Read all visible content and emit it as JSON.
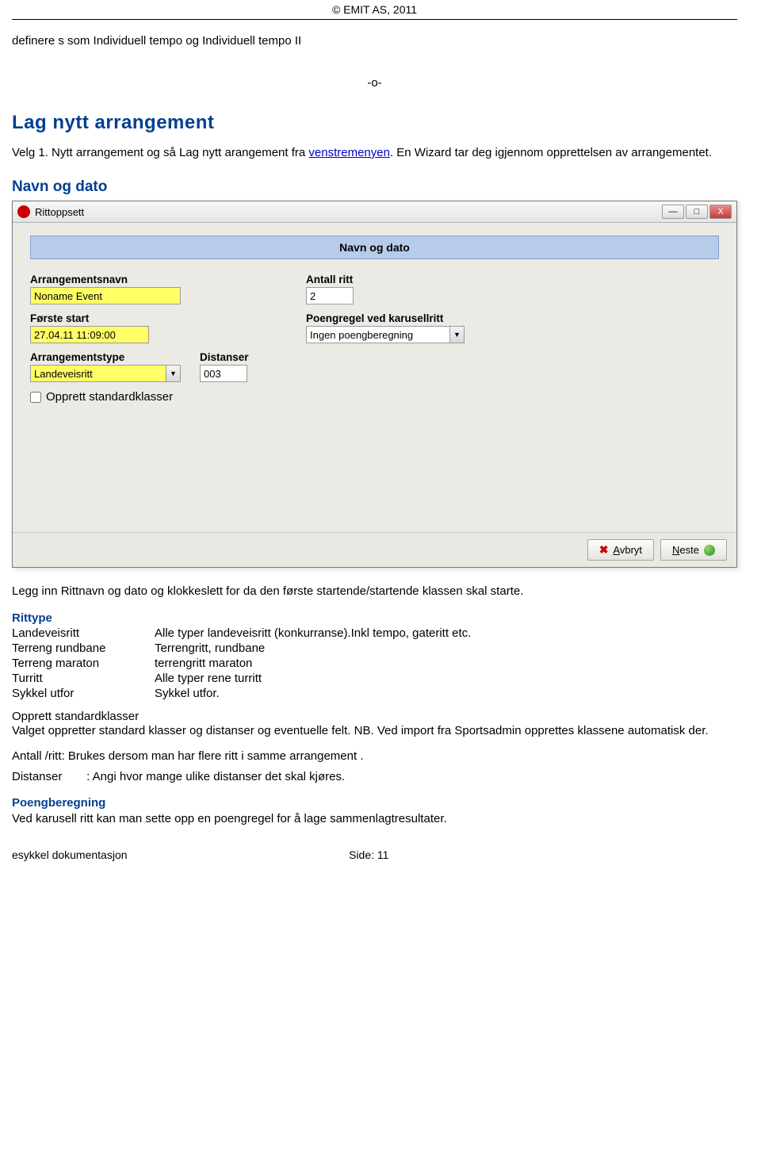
{
  "header": {
    "copyright": "© EMIT AS, 2011"
  },
  "intro": "definere s som Individuell tempo og Individuell tempo II",
  "divider": "-o-",
  "section": {
    "title": "Lag nytt arrangement",
    "p1a": "Velg 1. Nytt arrangement og så Lag nytt arangement fra ",
    "p1_link": "venstremenyen",
    "p1b": ". En Wizard tar deg igjennom opprettelsen av arrangementet.",
    "sub": "Navn og dato"
  },
  "window": {
    "title": "Rittoppsett",
    "min": "—",
    "max": "□",
    "close": "X",
    "dialog_title": "Navn og dato",
    "labels": {
      "arr_name": "Arrangementsnavn",
      "antall": "Antall ritt",
      "first_start": "Første start",
      "poeng": "Poengregel ved karusellritt",
      "arr_type": "Arrangementstype",
      "dist": "Distanser",
      "opprett": "Opprett standardklasser"
    },
    "values": {
      "arr_name": "Noname Event",
      "antall": "2",
      "first_start": "27.04.11 11:09:00",
      "poeng": "Ingen poengberegning",
      "arr_type": "Landeveisritt",
      "dist": "003"
    },
    "buttons": {
      "cancel": "Avbryt",
      "next": "Neste"
    }
  },
  "post": {
    "p1": "Legg inn Rittnavn og dato og klokkeslett for da den første startende/startende klassen skal starte.",
    "rittype_title": "Rittype",
    "rittype": [
      {
        "k": "Landeveisritt",
        "v": "Alle typer landeveisritt (konkurranse).Inkl tempo, gateritt etc."
      },
      {
        "k": "Terreng rundbane",
        "v": "Terrengritt, rundbane"
      },
      {
        "k": "Terreng maraton",
        "v": "terrengritt maraton"
      },
      {
        "k": "Turritt",
        "v": "Alle typer rene turritt"
      },
      {
        "k": "Sykkel utfor",
        "v": "Sykkel utfor."
      }
    ],
    "opprett_title": "Opprett standardklasser",
    "opprett_text": "Valget oppretter standard klasser og distanser og eventuelle felt. NB. Ved import fra Sportsadmin opprettes klassene automatisk der.",
    "antall_line": "Antall /ritt: Brukes dersom man har flere ritt i samme arrangement .",
    "dist_line_k": "Distanser",
    "dist_line_v": ": Angi hvor mange ulike distanser det skal kjøres.",
    "poeng_title": "Poengberegning",
    "poeng_text": "Ved karusell ritt kan man sette opp en poengregel for å lage sammenlagtresultater."
  },
  "footer": {
    "left": "esykkel dokumentasjon",
    "page": "Side: 11"
  }
}
